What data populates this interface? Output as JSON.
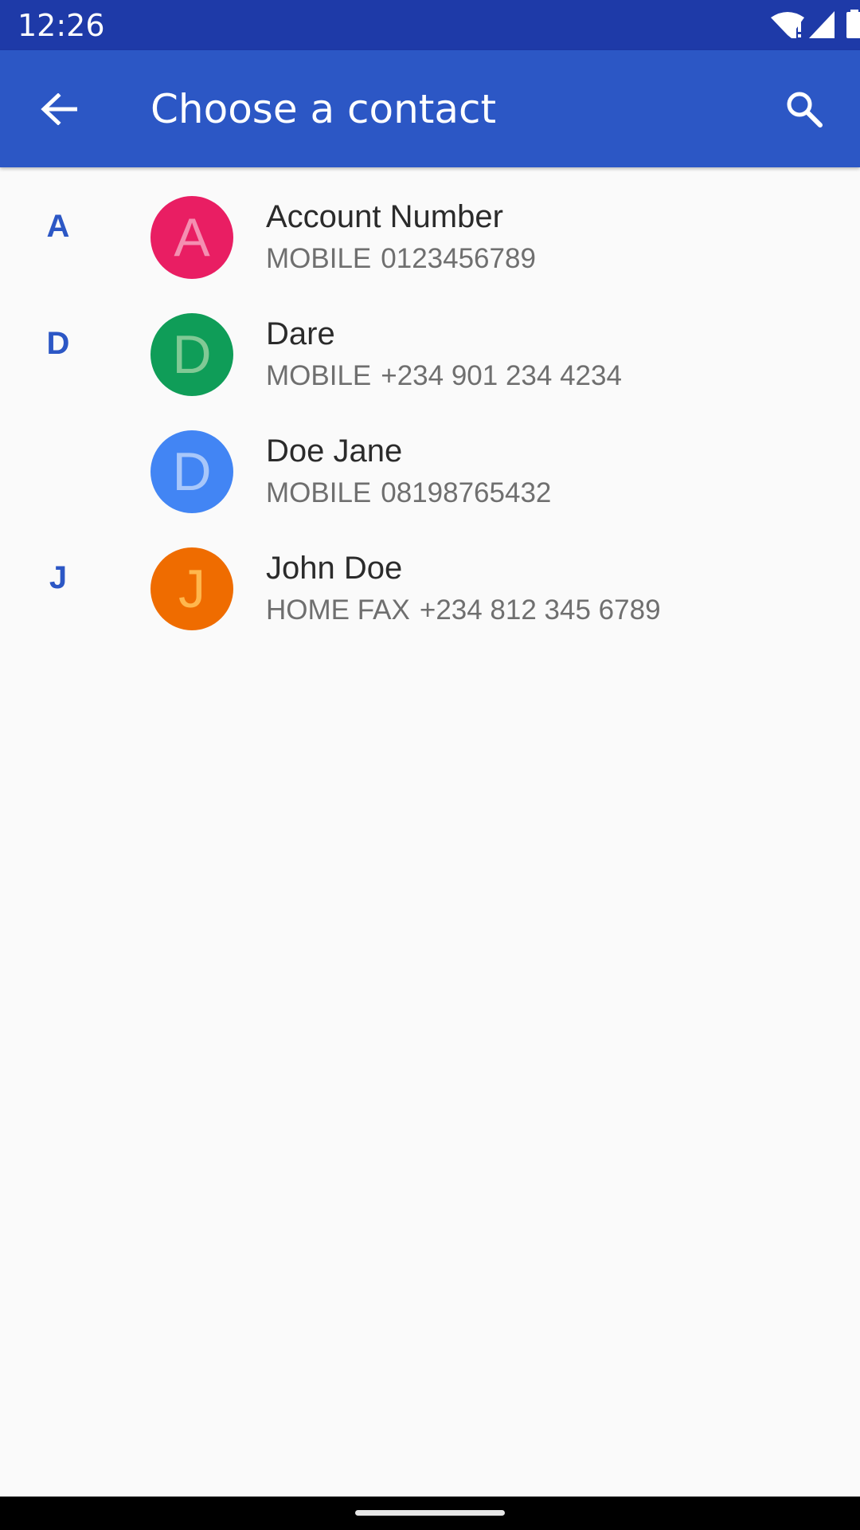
{
  "status_bar": {
    "time": "12:26",
    "icons": [
      "wifi-alert-icon",
      "cell-signal-icon",
      "battery-icon"
    ]
  },
  "app_bar": {
    "title": "Choose a contact",
    "back_icon": "arrow-back-icon",
    "search_icon": "search-icon",
    "color": "#2c57c5"
  },
  "contacts": [
    {
      "section": "A",
      "initial": "A",
      "name": "Account Number",
      "type": "MOBILE",
      "phone": "0123456789",
      "avatar_color": "#e91e63",
      "initial_color": "#f48fb1"
    },
    {
      "section": "D",
      "initial": "D",
      "name": "Dare",
      "type": "MOBILE",
      "phone": "+234 901 234 4234",
      "avatar_color": "#0f9d58",
      "initial_color": "#81c995"
    },
    {
      "section": "",
      "initial": "D",
      "name": "Doe Jane",
      "type": "MOBILE",
      "phone": "08198765432",
      "avatar_color": "#4285f4",
      "initial_color": "#a8c7fa"
    },
    {
      "section": "J",
      "initial": "J",
      "name": "John Doe",
      "type": "HOME FAX",
      "phone": "+234 812 345 6789",
      "avatar_color": "#ef6c00",
      "initial_color": "#ffb74d"
    }
  ]
}
